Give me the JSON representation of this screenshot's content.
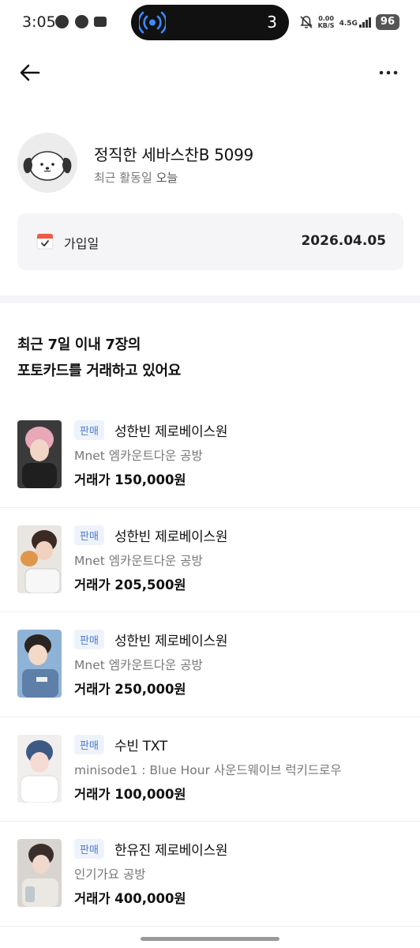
{
  "status_bar": {
    "time": "3:05",
    "island_number": "3",
    "speed_value": "0.00",
    "speed_unit": "KB/S",
    "network": "4.5G",
    "battery": "96"
  },
  "header": {
    "back_icon": "arrow-left-icon",
    "more_icon": "more-horizontal-icon"
  },
  "profile": {
    "nickname": "정직한 세바스찬B 5099",
    "last_active_label": "최근 활동일",
    "last_active_value": "오늘",
    "avatar_icon": "dog-avatar-icon"
  },
  "join": {
    "label": "가입일",
    "date": "2026.04.05",
    "icon": "calendar-check-icon"
  },
  "summary": {
    "line1": "최근 7일 이내 7장의",
    "line2": "포토카드를 거래하고 있어요"
  },
  "trades": [
    {
      "badge": "판매",
      "title": "성한빈 제로베이스원",
      "subtitle": "Mnet 엠카운트다운 공방",
      "price": "거래가 150,000원",
      "thumb_color": "#3a3a3a",
      "hair_color": "#e8a8b8"
    },
    {
      "badge": "판매",
      "title": "성한빈 제로베이스원",
      "subtitle": "Mnet 엠카운트다운 공방",
      "price": "거래가 205,500원",
      "thumb_color": "#e9e6e2",
      "hair_color": "#3b2a24"
    },
    {
      "badge": "판매",
      "title": "성한빈 제로베이스원",
      "subtitle": "Mnet 엠카운트다운 공방",
      "price": "거래가 250,000원",
      "thumb_color": "#5d7fa8",
      "hair_color": "#2b2320"
    },
    {
      "badge": "판매",
      "title": "수빈 TXT",
      "subtitle": "minisode1 : Blue Hour 사운드웨이브 럭키드로우",
      "price": "거래가 100,000원",
      "thumb_color": "#f1eeee",
      "hair_color": "#3c5a84"
    },
    {
      "badge": "판매",
      "title": "한유진 제로베이스원",
      "subtitle": "인기가요 공방",
      "price": "거래가 400,000원",
      "thumb_color": "#d8d4d0",
      "hair_color": "#3a2e2c"
    }
  ],
  "colors": {
    "accent_blue": "#4a7bd0",
    "badge_bg": "#eef3fb",
    "card_bg": "#f5f5f7"
  }
}
